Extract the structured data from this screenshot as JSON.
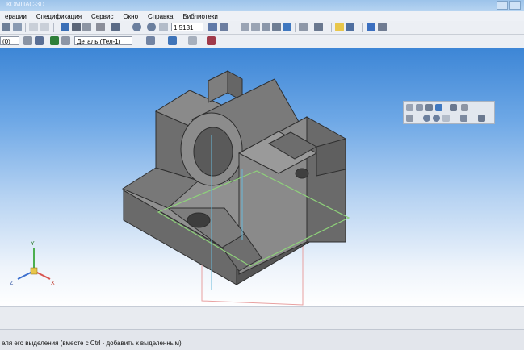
{
  "window": {
    "title": "КОМПАС-3D"
  },
  "menu": [
    "ерации",
    "Спецификация",
    "Сервис",
    "Окно",
    "Справка",
    "Библиотеки"
  ],
  "toolbar": {
    "zoom_value": "1.5131",
    "layer_value": "(0)",
    "object_selector": "Деталь (Тел-1)"
  },
  "axes": {
    "x": "X",
    "y": "Y",
    "z": "Z"
  },
  "status": {
    "hint": "еля его выделения (вместе с Ctrl - добавить к выделенным)"
  },
  "colors": {
    "viewport_top": "#3d86d6",
    "viewport_bottom": "#ffffff",
    "part_face": "#7a7a7a",
    "plane_green": "#8ed27a",
    "plane_red": "#e8a0a0",
    "axis_cyan": "#69b9d9"
  }
}
